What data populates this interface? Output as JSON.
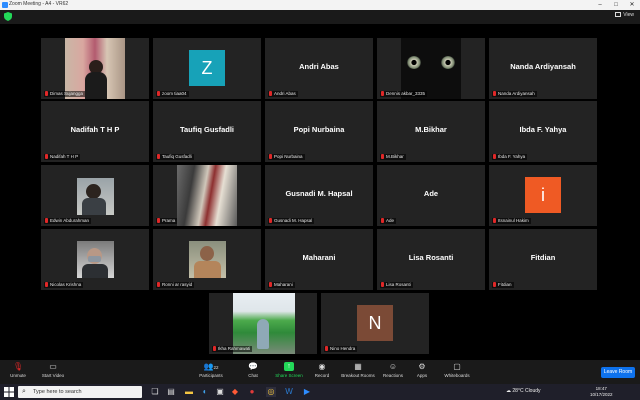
{
  "window": {
    "title": "Zoom Meeting - A4 - VR62"
  },
  "topbar": {
    "view_label": "View"
  },
  "participants": [
    {
      "name": "Dimas Sujangga",
      "display": "",
      "type": "video"
    },
    {
      "name": "zoom tiaa04",
      "display": "Z",
      "type": "avatar",
      "avatar_color": "#17a2b8"
    },
    {
      "name": "Andri Abas",
      "display": "Andri Abas",
      "type": "name"
    },
    {
      "name": "Dennis akbar_3335",
      "display": "",
      "type": "video"
    },
    {
      "name": "Nanda Ardiyansah",
      "display": "Nanda Ardiyansah",
      "type": "name"
    },
    {
      "name": "Nadifah T H P",
      "display": "Nadifah T H P",
      "type": "name"
    },
    {
      "name": "Taufiq Gusfadli",
      "display": "Taufiq Gusfadli",
      "type": "name"
    },
    {
      "name": "Popi Nurbaina",
      "display": "Popi Nurbaina",
      "type": "name"
    },
    {
      "name": "M.Bikhar",
      "display": "M.Bikhar",
      "type": "name"
    },
    {
      "name": "Ibda F. Yahya",
      "display": "Ibda F. Yahya",
      "type": "name"
    },
    {
      "name": "Edwin Abdurahman",
      "display": "",
      "type": "video"
    },
    {
      "name": "Prama",
      "display": "",
      "type": "video"
    },
    {
      "name": "Gusnadi M. Hapsal",
      "display": "Gusnadi M. Hapsal",
      "type": "name"
    },
    {
      "name": "Ade",
      "display": "Ade",
      "type": "name"
    },
    {
      "name": "Itsnainul Hakim",
      "display": "i",
      "type": "avatar",
      "avatar_color": "#ef5a24"
    },
    {
      "name": "Nicolas Krishna",
      "display": "",
      "type": "video"
    },
    {
      "name": "Ronni ar rasyid",
      "display": "",
      "type": "video"
    },
    {
      "name": "Maharani",
      "display": "Maharani",
      "type": "name"
    },
    {
      "name": "Lisa Rosanti",
      "display": "Lisa Rosanti",
      "type": "name"
    },
    {
      "name": "Fitdian",
      "display": "Fitdian",
      "type": "name"
    },
    {
      "name": "Ikha Rahmawati",
      "display": "",
      "type": "video"
    },
    {
      "name": "Nino Hendra",
      "display": "N",
      "type": "avatar",
      "avatar_color": "#7b4a36"
    }
  ],
  "toolbar": {
    "unmute": "Unmute",
    "start_video": "Start Video",
    "participants": "Participants",
    "participants_count": "22",
    "chat": "Chat",
    "share_screen": "Share Screen",
    "record": "Record",
    "breakout_rooms": "Breakout Rooms",
    "reactions": "Reactions",
    "apps": "Apps",
    "whiteboards": "Whiteboards",
    "leave": "Leave Room"
  },
  "taskbar": {
    "search_placeholder": "Type here to search",
    "weather": "28°C  Cloudy",
    "time": "18:47",
    "date": "10/17/2022"
  },
  "colors": {
    "accent": "#0e72ed",
    "share_green": "#23d959",
    "mute_red": "#e02828"
  }
}
